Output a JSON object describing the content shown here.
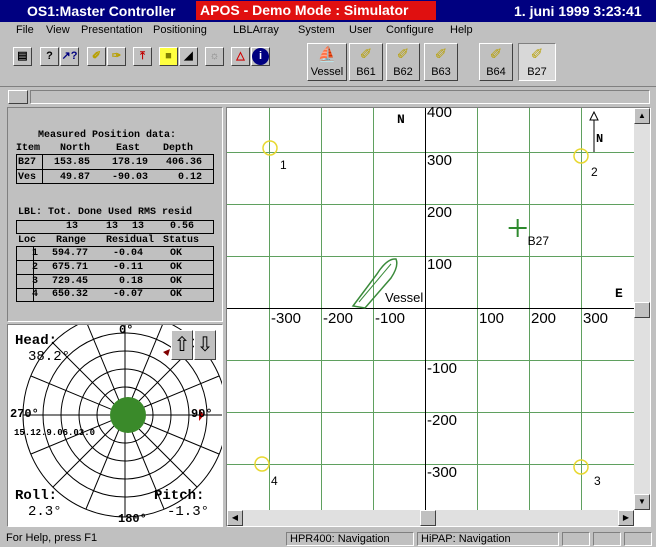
{
  "titlebar": {
    "app_title": "OS1:Master Controller",
    "mode_text": "APOS - Demo Mode : Simulator Active -",
    "datetime": "1. juni 1999 3:23:41"
  },
  "menu": [
    "File",
    "View",
    "Presentation",
    "Positioning",
    "LBLArray",
    "System",
    "User",
    "Configure",
    "Help"
  ],
  "toolbar": {
    "icons": [
      "print-icon",
      "help-icon",
      "context-help-icon",
      "transponder-edit-icon",
      "transponder-icon",
      "calibrate-icon",
      "highlight-icon",
      "contrast-icon",
      "settings-icon",
      "alarm-icon",
      "info-icon"
    ],
    "targets": [
      "Vessel",
      "B61",
      "B62",
      "B63",
      "B64",
      "B27"
    ],
    "selected_target": "B27"
  },
  "position": {
    "heading": "Measured Position data:",
    "columns": [
      "Item",
      "North",
      "East",
      "Depth"
    ],
    "rows": [
      [
        "B27",
        "153.85",
        "178.19",
        "406.36"
      ],
      [
        "Ves",
        "49.87",
        "-90.03",
        "0.12"
      ]
    ]
  },
  "lbl": {
    "summary_header": "LBL: Tot. Done Used RMS resid",
    "summary_values": [
      "13",
      "13",
      "13",
      "0.56"
    ],
    "columns": [
      "Loc",
      "Range",
      "Residual",
      "Status"
    ],
    "rows": [
      [
        "1",
        "594.77",
        "-0.04",
        "OK"
      ],
      [
        "2",
        "675.71",
        "-0.11",
        "OK"
      ],
      [
        "3",
        "729.45",
        "0.18",
        "OK"
      ],
      [
        "4",
        "650.32",
        "-0.07",
        "OK"
      ]
    ]
  },
  "attitude": {
    "head_label": "Head:",
    "head_value": "38.2°",
    "roll_label": "Roll:",
    "roll_value": "2.3°",
    "pitch_label": "Pitch:",
    "pitch_value": "-1.3°",
    "compass_labels": [
      "0°",
      "90°",
      "180°",
      "270°"
    ],
    "range_labels": "15.12.9.06.03.0"
  },
  "map": {
    "north_label": "N",
    "east_label": "E",
    "north_arrow_label": "N",
    "x_ticks": [
      "-300",
      "-200",
      "-100",
      "100",
      "200",
      "300"
    ],
    "y_ticks": [
      "400",
      "300",
      "200",
      "100",
      "-100",
      "-200",
      "-300"
    ],
    "vessel_label": "Vessel",
    "target_label": "B27",
    "transponders": [
      "1",
      "2",
      "3",
      "4"
    ],
    "grid_color": "#5fa05f",
    "transponder_color": "#e8d830",
    "vessel_color": "#3a8a3a",
    "target": {
      "east": 178.19,
      "north": 153.85
    }
  },
  "status": {
    "help": "For Help, press F1",
    "hpr": "HPR400: Navigation",
    "hipap": "HiPAP: Navigation"
  }
}
